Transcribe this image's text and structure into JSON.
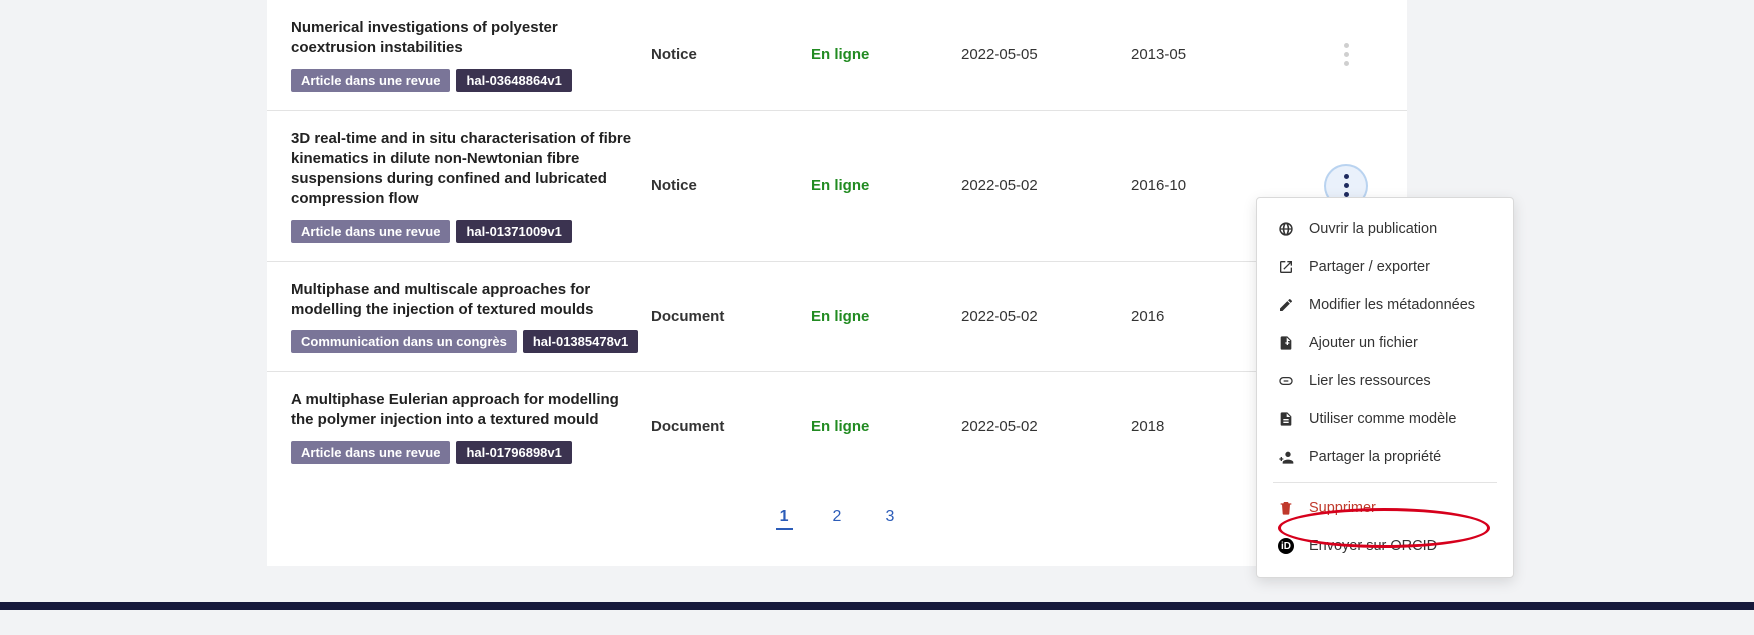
{
  "rows": [
    {
      "title": "Numerical investigations of polyester coextrusion instabilities",
      "typeBadge": "Article dans une revue",
      "idBadge": "hal-03648864v1",
      "col2": "Notice",
      "status": "En ligne",
      "date1": "2022-05-05",
      "date2": "2013-05",
      "active": false
    },
    {
      "title": "3D real-time and in situ characterisation of fibre kinematics in dilute non-Newtonian fibre suspensions during confined and lubricated compression flow",
      "typeBadge": "Article dans une revue",
      "idBadge": "hal-01371009v1",
      "col2": "Notice",
      "status": "En ligne",
      "date1": "2022-05-02",
      "date2": "2016-10",
      "active": true
    },
    {
      "title": "Multiphase and multiscale approaches for modelling the injection of textured moulds",
      "typeBadge": "Communication dans un congrès",
      "idBadge": "hal-01385478v1",
      "col2": "Document",
      "status": "En ligne",
      "date1": "2022-05-02",
      "date2": "2016",
      "active": false
    },
    {
      "title": "A multiphase Eulerian approach for modelling the polymer injection into a textured mould",
      "typeBadge": "Article dans une revue",
      "idBadge": "hal-01796898v1",
      "col2": "Document",
      "status": "En ligne",
      "date1": "2022-05-02",
      "date2": "2018",
      "active": false
    }
  ],
  "pagination": {
    "pages": [
      "1",
      "2",
      "3"
    ],
    "current": "1"
  },
  "menu": {
    "open": "Ouvrir la publication",
    "share": "Partager / exporter",
    "edit": "Modifier les métadonnées",
    "addfile": "Ajouter un fichier",
    "link": "Lier les ressources",
    "template": "Utiliser comme modèle",
    "shareOwn": "Partager la propriété",
    "delete": "Supprimer",
    "orcid": "Envoyer sur ORCID"
  }
}
